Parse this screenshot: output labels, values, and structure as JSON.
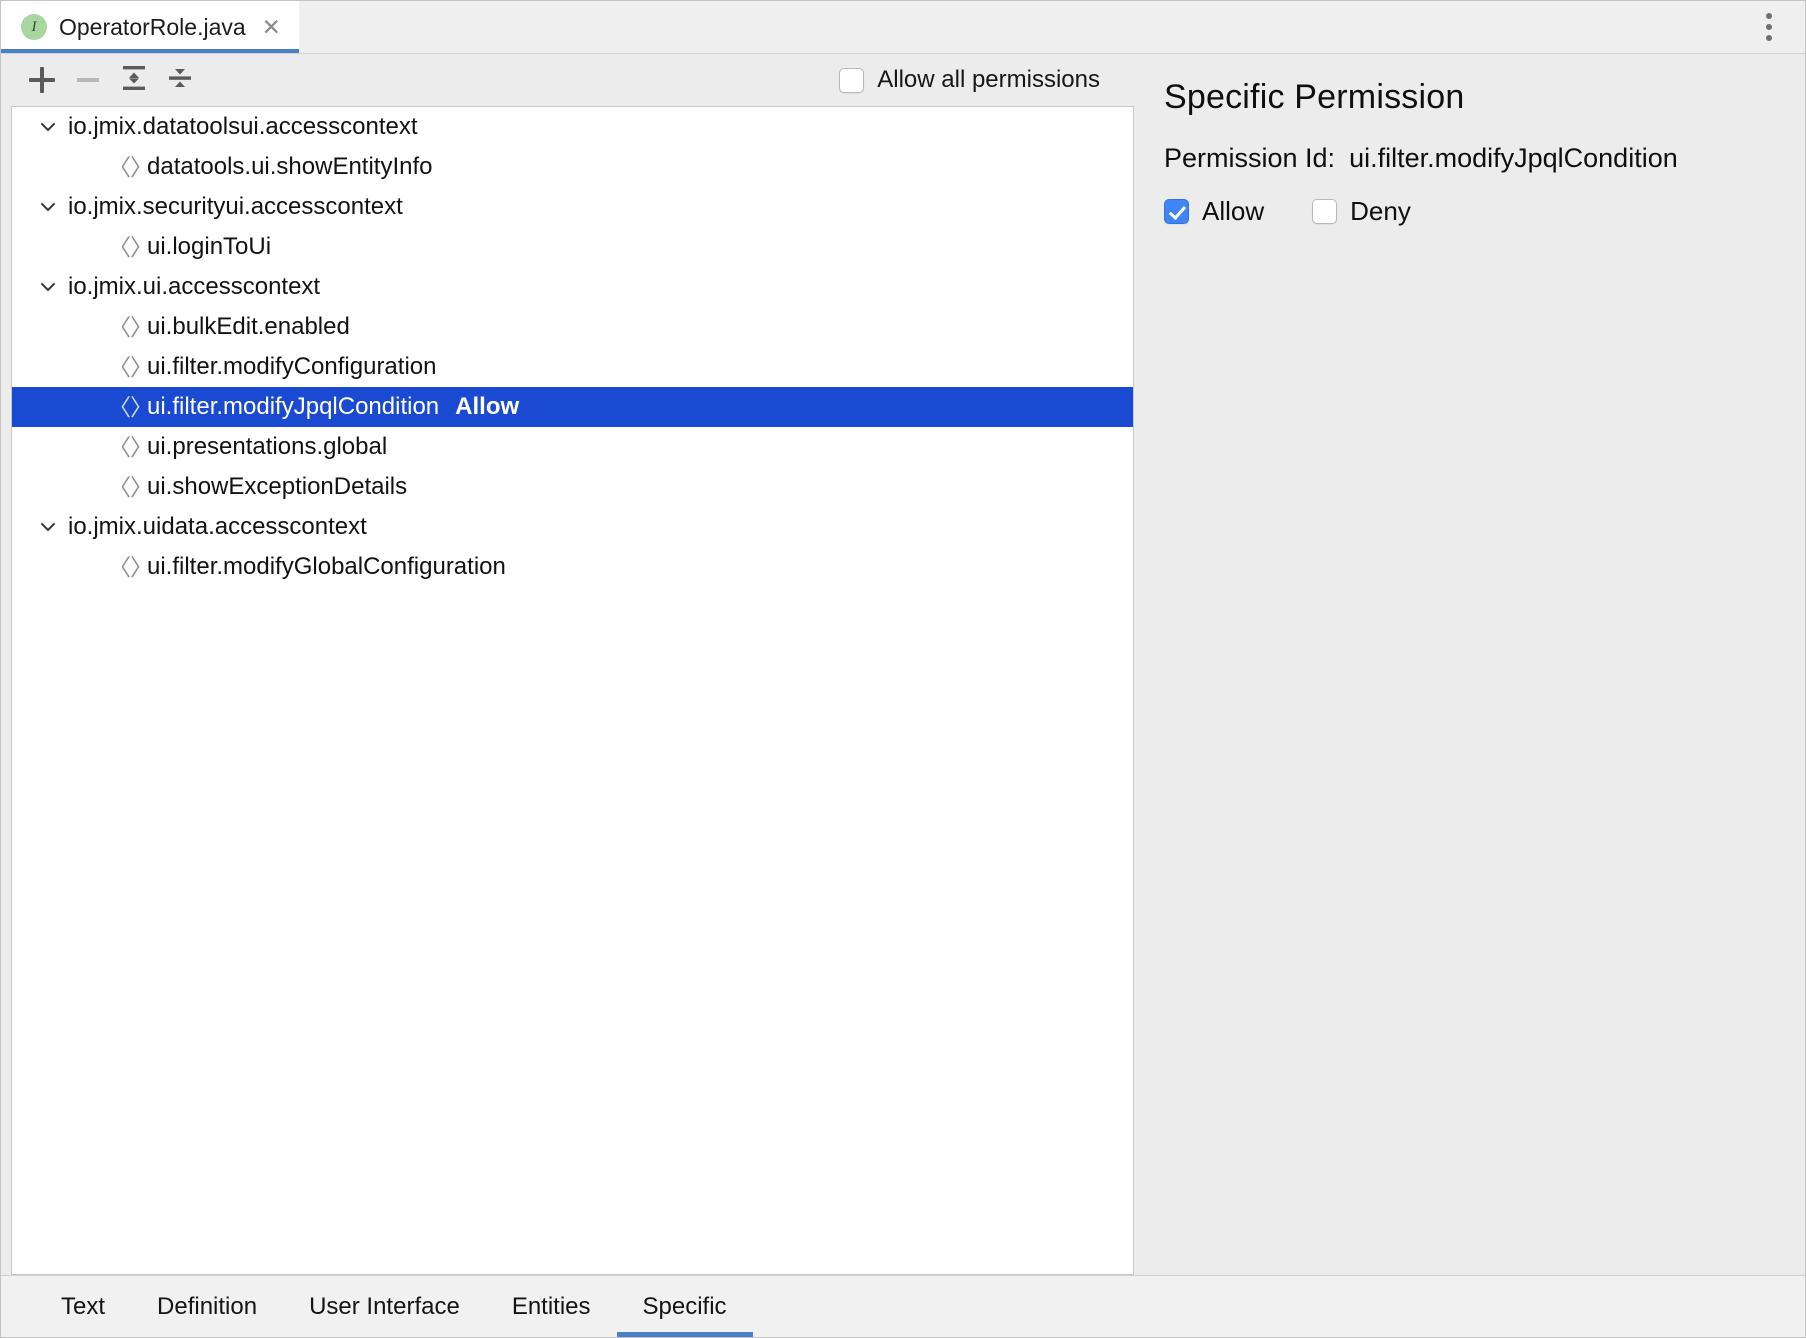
{
  "window": {
    "kebab_icon": "more-vertical-icon"
  },
  "editor_tab": {
    "icon_letter": "I",
    "icon_name": "java-interface-icon",
    "filename": "OperatorRole.java",
    "close_glyph": "✕"
  },
  "toolbar": {
    "add_label": "+",
    "remove_label": "−",
    "expand_all_name": "expand-all-icon",
    "collapse_all_name": "collapse-all-icon",
    "allow_all_label": "Allow all permissions",
    "allow_all_checked": false
  },
  "tree": {
    "diamond_glyph": "〈〉",
    "nodes": [
      {
        "type": "group",
        "label": "io.jmix.datatoolsui.accesscontext",
        "expanded": true,
        "children": [
          {
            "type": "leaf",
            "label": "datatools.ui.showEntityInfo",
            "state": "",
            "selected": false
          }
        ]
      },
      {
        "type": "group",
        "label": "io.jmix.securityui.accesscontext",
        "expanded": true,
        "children": [
          {
            "type": "leaf",
            "label": "ui.loginToUi",
            "state": "",
            "selected": false
          }
        ]
      },
      {
        "type": "group",
        "label": "io.jmix.ui.accesscontext",
        "expanded": true,
        "children": [
          {
            "type": "leaf",
            "label": "ui.bulkEdit.enabled",
            "state": "",
            "selected": false
          },
          {
            "type": "leaf",
            "label": "ui.filter.modifyConfiguration",
            "state": "",
            "selected": false
          },
          {
            "type": "leaf",
            "label": "ui.filter.modifyJpqlCondition",
            "state": "Allow",
            "selected": true
          },
          {
            "type": "leaf",
            "label": "ui.presentations.global",
            "state": "",
            "selected": false
          },
          {
            "type": "leaf",
            "label": "ui.showExceptionDetails",
            "state": "",
            "selected": false
          }
        ]
      },
      {
        "type": "group",
        "label": "io.jmix.uidata.accesscontext",
        "expanded": true,
        "children": [
          {
            "type": "leaf",
            "label": "ui.filter.modifyGlobalConfiguration",
            "state": "",
            "selected": false
          }
        ]
      }
    ]
  },
  "detail": {
    "title": "Specific Permission",
    "permission_id_label": "Permission Id:",
    "permission_id_value": "ui.filter.modifyJpqlCondition",
    "allow_label": "Allow",
    "allow_checked": true,
    "deny_label": "Deny",
    "deny_checked": false
  },
  "bottom_tabs": {
    "items": [
      {
        "label": "Text",
        "active": false
      },
      {
        "label": "Definition",
        "active": false
      },
      {
        "label": "User Interface",
        "active": false
      },
      {
        "label": "Entities",
        "active": false
      },
      {
        "label": "Specific",
        "active": true
      }
    ]
  },
  "colors": {
    "selection_blue": "#1b4ad2",
    "accent_underline": "#4a81c4",
    "checkbox_blue": "#3f85f5",
    "panel_bg": "#ececec",
    "tree_bg": "#ffffff"
  }
}
